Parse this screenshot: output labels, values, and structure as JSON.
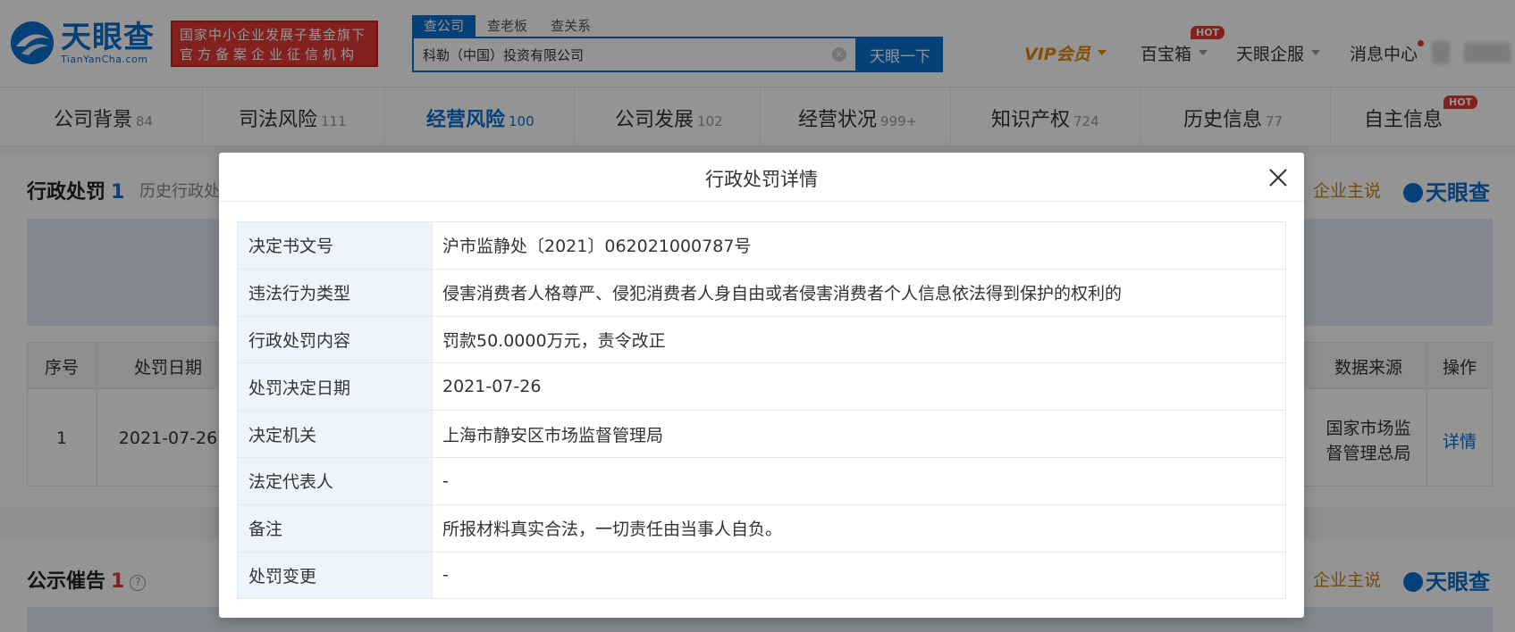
{
  "header": {
    "logo_cn": "天眼查",
    "logo_en": "TianYanCha.com",
    "fund_line1": "国家中小企业发展子基金旗下",
    "fund_line2": "官方备案企业征信机构",
    "search_tabs": [
      "查公司",
      "查老板",
      "查关系"
    ],
    "search_value": "科勒（中国）投资有限公司",
    "search_button": "天眼一下",
    "vip": "VIP会员",
    "treasure": "百宝箱",
    "hot": "HOT",
    "enterprise_service": "天眼企服",
    "message_center": "消息中心"
  },
  "categories": [
    {
      "label": "公司背景",
      "count": "84"
    },
    {
      "label": "司法风险",
      "count": "111"
    },
    {
      "label": "经营风险",
      "count": "100"
    },
    {
      "label": "公司发展",
      "count": "102"
    },
    {
      "label": "经营状况",
      "count": "999+"
    },
    {
      "label": "知识产权",
      "count": "724"
    },
    {
      "label": "历史信息",
      "count": "77"
    },
    {
      "label": "自主信息",
      "count": ""
    }
  ],
  "penalty_section": {
    "title": "行政处罚",
    "count": "1",
    "history_tab": "历史行政处",
    "enterprise_say": "企业主说",
    "brand": "天眼查",
    "table_headers": {
      "index": "序号",
      "date": "处罚日期",
      "source": "数据来源",
      "action": "操作"
    },
    "row": {
      "index": "1",
      "date": "2021-07-26",
      "source_line1": "国家市场监",
      "source_line2": "督管理总局",
      "action": "详情"
    }
  },
  "notice_section": {
    "title": "公示催告",
    "count": "1",
    "enterprise_say": "企业主说",
    "brand": "天眼查"
  },
  "modal": {
    "title": "行政处罚详情",
    "rows": [
      {
        "key": "决定书文号",
        "value": "沪市监静处〔2021〕062021000787号"
      },
      {
        "key": "违法行为类型",
        "value": "侵害消费者人格尊严、侵犯消费者人身自由或者侵害消费者个人信息依法得到保护的权利的"
      },
      {
        "key": "行政处罚内容",
        "value": "罚款50.0000万元，责令改正"
      },
      {
        "key": "处罚决定日期",
        "value": "2021-07-26"
      },
      {
        "key": "决定机关",
        "value": "上海市静安区市场监督管理局"
      },
      {
        "key": "法定代表人",
        "value": "-"
      },
      {
        "key": "备注",
        "value": "所报材料真实合法，一切责任由当事人自负。"
      },
      {
        "key": "处罚变更",
        "value": "-"
      }
    ]
  },
  "colors": {
    "brand_blue": "#0a6ed1",
    "hot_red": "#e23a36",
    "vip_orange": "#e08a00"
  }
}
